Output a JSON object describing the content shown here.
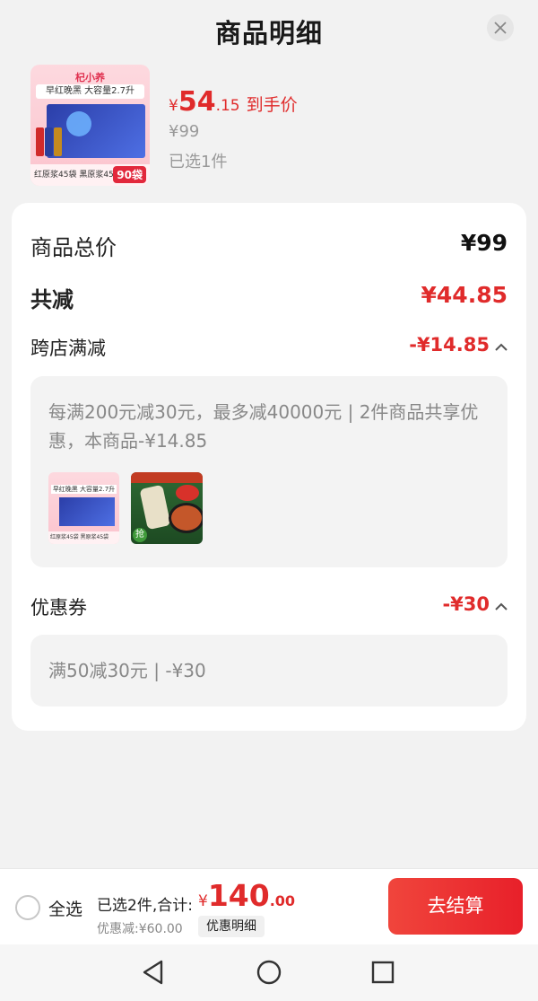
{
  "header": {
    "title": "商品明细",
    "close_icon": "close-icon"
  },
  "product": {
    "image": {
      "brand": "杞小养",
      "tagline": "早红晚黑 大容量2.7升",
      "bottom_text": "红原浆45袋 黑原浆45袋",
      "badge": "90袋"
    },
    "price": {
      "currency": "¥",
      "integer": "54",
      "decimal": ".15",
      "tag": "到手价"
    },
    "original_price": "¥99",
    "selected_count": "已选1件"
  },
  "breakdown": {
    "total": {
      "label": "商品总价",
      "value": "¥99"
    },
    "reduction": {
      "label": "共减",
      "value": "¥44.85"
    },
    "cross_store": {
      "label": "跨店满减",
      "value": "-¥14.85",
      "detail": "每满200元减30元，最多减40000元 | 2件商品共享优惠，本商品-¥14.85",
      "thumbs": [
        {
          "tagline": "早红晚黑 大容量2.7升",
          "bottom_text": "红原浆45袋 黑原浆45袋"
        },
        {
          "grab": "抢"
        }
      ]
    },
    "coupon": {
      "label": "优惠券",
      "value": "-¥30",
      "detail": "满50减30元 | -¥30"
    }
  },
  "bottom_bar": {
    "select_all": "全选",
    "summary": "已选2件,合计:",
    "total": {
      "currency": "¥",
      "integer": "140",
      "decimal": ".00"
    },
    "savings": "优惠减:¥60.00",
    "promo_detail_button": "优惠明细",
    "checkout_button": "去结算"
  },
  "colors": {
    "accent": "#e02b2b",
    "background": "#f2f2f2",
    "card": "#ffffff"
  },
  "nav_icons": [
    "back-icon",
    "home-icon",
    "recents-icon"
  ]
}
